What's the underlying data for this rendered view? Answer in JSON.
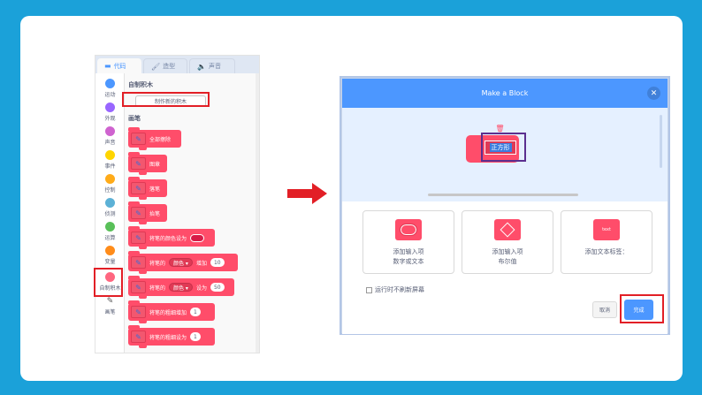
{
  "tabs": {
    "code": "代码",
    "costume": "造型",
    "sound": "声音"
  },
  "categories": [
    {
      "label": "运动",
      "color": "#4c97ff"
    },
    {
      "label": "外观",
      "color": "#9966ff"
    },
    {
      "label": "声音",
      "color": "#cf63cf"
    },
    {
      "label": "事件",
      "color": "#ffd500"
    },
    {
      "label": "控制",
      "color": "#ffab19"
    },
    {
      "label": "侦测",
      "color": "#5cb1d6"
    },
    {
      "label": "运算",
      "color": "#59c059"
    },
    {
      "label": "变量",
      "color": "#ff8c1a"
    },
    {
      "label": "自制积木",
      "color": "#ff6680"
    },
    {
      "label": "画笔",
      "color": ""
    }
  ],
  "palette": {
    "my_blocks_heading": "自制积木",
    "make_block_button": "制作新的积木",
    "pen_heading": "画笔",
    "blocks": [
      {
        "text": "全部擦除"
      },
      {
        "text": "图章"
      },
      {
        "text": "落笔"
      },
      {
        "text": "抬笔"
      },
      {
        "text": "将笔的颜色设为"
      },
      {
        "text": "将笔的",
        "dropdown": "颜色 ▾",
        "text2": "增加",
        "value": "10"
      },
      {
        "text": "将笔的",
        "dropdown": "颜色 ▾",
        "text2": "设为",
        "value": "50"
      },
      {
        "text": "将笔的粗细增加",
        "value": "1"
      },
      {
        "text": "将笔的粗细设为",
        "value": "1"
      }
    ]
  },
  "dialog": {
    "title": "Make a Block",
    "block_name_input": "正方形",
    "options": [
      {
        "line1": "添加输入项",
        "line2": "数字或文本"
      },
      {
        "line1": "添加输入项",
        "line2": "布尔值"
      },
      {
        "line1": "添加文本标签：",
        "line2": "",
        "chip": "text"
      }
    ],
    "run_without_refresh": "运行时不刷新屏幕",
    "cancel": "取消",
    "done": "完成"
  },
  "colors": {
    "background": "#1ba1d9",
    "highlight_red": "#e21f26",
    "highlight_purple": "#5b2f8f",
    "dialog_header": "#4c97ff",
    "block_pink": "#ff4d6a"
  }
}
